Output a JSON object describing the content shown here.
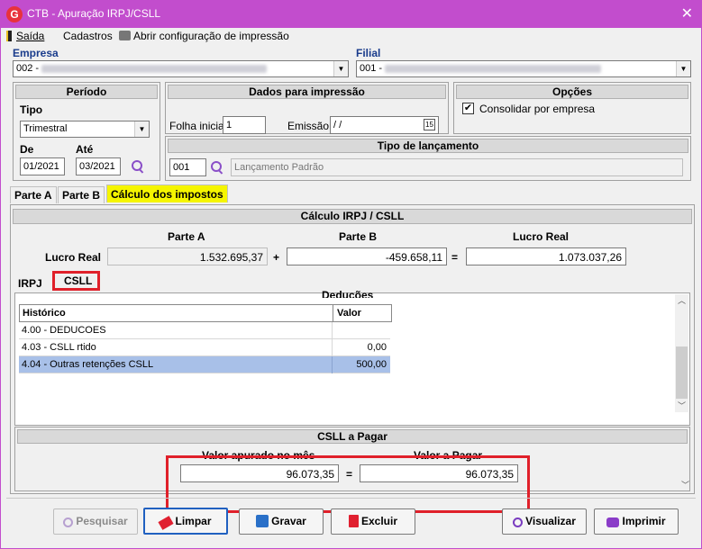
{
  "window": {
    "title": "CTB - Apuração IRPJ/CSLL",
    "logo_letter": "G",
    "close_glyph": "✕"
  },
  "menu": {
    "saida": "Saída",
    "cadastros": "Cadastros",
    "print_config": "Abrir configuração de impressão"
  },
  "empresa": {
    "label": "Empresa",
    "value": "002 -"
  },
  "filial": {
    "label": "Filial",
    "value": "001 -"
  },
  "periodo": {
    "title": "Período",
    "tipo_label": "Tipo",
    "tipo_value": "Trimestral",
    "de_label": "De",
    "ate_label": "Até",
    "de_value": "01/2021",
    "ate_value": "03/2021"
  },
  "dados_impressao": {
    "title": "Dados para impressão",
    "folha_label": "Folha inicial",
    "folha_value": "1",
    "emissao_label": "Emissão",
    "emissao_value": " /  /",
    "cal_icon": "15"
  },
  "opcoes": {
    "title": "Opções",
    "consolidar_label": "Consolidar por empresa",
    "consolidar_checked": true
  },
  "tipo_lancamento": {
    "title": "Tipo de lançamento",
    "code": "001",
    "description": "Lançamento Padrão"
  },
  "tabs": {
    "parte_a": "Parte A",
    "parte_b": "Parte B",
    "calculo": "Cálculo dos impostos"
  },
  "calculo": {
    "title": "Cálculo IRPJ / CSLL",
    "parte_a_label": "Parte A",
    "parte_b_label": "Parte B",
    "lucro_real_label": "Lucro Real",
    "row_label": "Lucro Real",
    "parte_a_value": "1.532.695,37",
    "plus": "+",
    "parte_b_value": "-459.658,11",
    "equals": "=",
    "lucro_real_value": "1.073.037,26"
  },
  "subtabs": {
    "irpj": "IRPJ",
    "csll": "CSLL"
  },
  "deducoes": {
    "title": "Deduções",
    "columns": [
      "Histórico",
      "Valor"
    ],
    "rows": [
      {
        "historico": "4.00 - DEDUCOES",
        "valor": ""
      },
      {
        "historico": "4.03 - CSLL rtido",
        "valor": "0,00"
      },
      {
        "historico": "4.04 - Outras retenções CSLL",
        "valor": "500,00"
      }
    ]
  },
  "csll_pagar": {
    "title": "CSLL a Pagar",
    "apurado_label": "Valor apurado no mês",
    "pagar_label": "Valor a Pagar",
    "apurado_value": "96.073,35",
    "equals": "=",
    "pagar_value": "96.073,35"
  },
  "buttons": {
    "pesquisar": "Pesquisar",
    "limpar": "Limpar",
    "gravar": "Gravar",
    "excluir": "Excluir",
    "visualizar": "Visualizar",
    "imprimir": "Imprimir"
  }
}
